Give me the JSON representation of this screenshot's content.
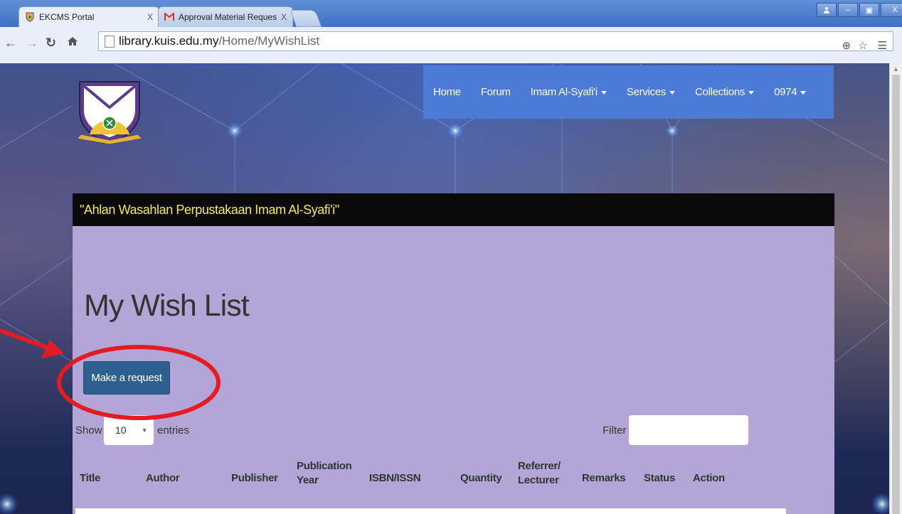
{
  "browser": {
    "tabs": [
      {
        "label": "EKCMS Portal",
        "close": "X"
      },
      {
        "label": "Approval Material Request -",
        "close": "X"
      }
    ],
    "window_controls": [
      "□",
      "–",
      "▣",
      "X"
    ],
    "url_host": "library.kuis.edu.my",
    "url_path": "/Home/MyWishList"
  },
  "nav": {
    "items": [
      "Home",
      "Forum",
      "Imam Al-Syafi'i",
      "Services",
      "Collections",
      "0974"
    ]
  },
  "banner": {
    "text": "\"Ahlan Wasahlan Perpustakaan Imam Al-Syafi'i\""
  },
  "main": {
    "title": "My Wish List",
    "request_button": "Make a request",
    "show_label": "Show",
    "entries_value": "10",
    "entries_label": "entries",
    "filter_label": "Filter",
    "filter_value": "",
    "columns": [
      {
        "label": "Title"
      },
      {
        "label": "Author"
      },
      {
        "label": "Publisher"
      },
      {
        "label": "Publication",
        "label2": "Year"
      },
      {
        "label": "ISBN/ISSN"
      },
      {
        "label": "Quantity"
      },
      {
        "label": "Referrer/",
        "label2": "Lecturer"
      },
      {
        "label": "Remarks"
      },
      {
        "label": "Status"
      },
      {
        "label": "Action"
      }
    ]
  },
  "colors": {
    "nav_bg": "#4c7ad7",
    "content_bg": "#b3a6d6",
    "button_bg": "#2d5f91",
    "banner_text": "#f4ec4f",
    "annotation": "#e31b23"
  }
}
